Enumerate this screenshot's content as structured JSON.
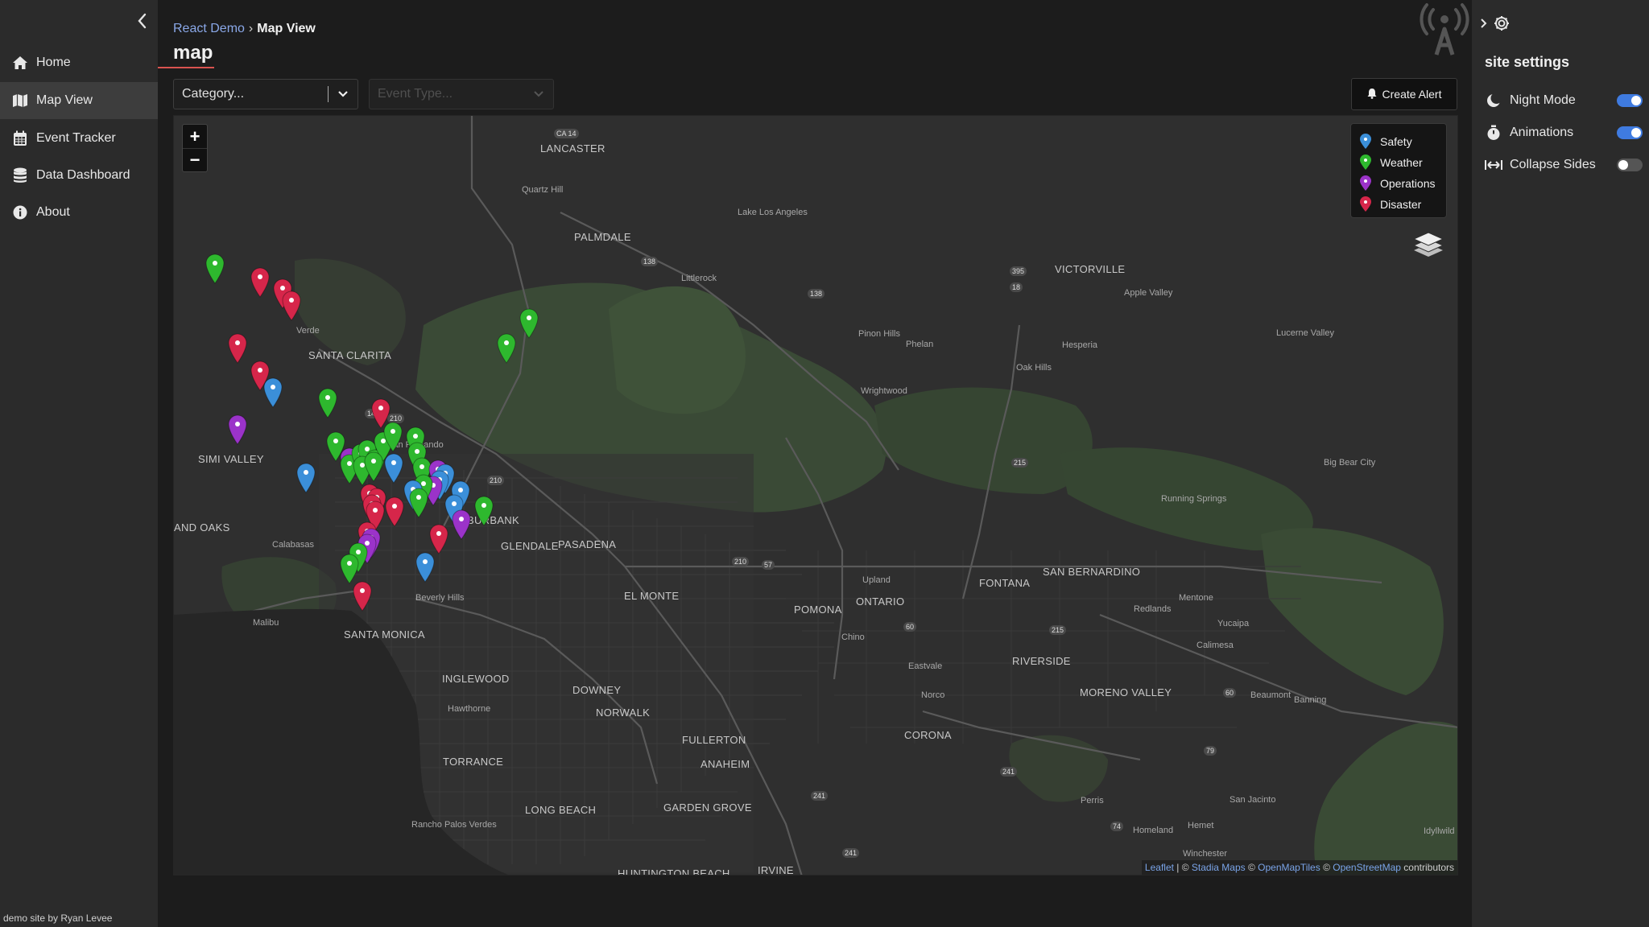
{
  "sidebar": {
    "items": [
      {
        "label": "Home",
        "icon": "home-icon"
      },
      {
        "label": "Map View",
        "icon": "map-icon"
      },
      {
        "label": "Event Tracker",
        "icon": "calendar-icon"
      },
      {
        "label": "Data Dashboard",
        "icon": "database-icon"
      },
      {
        "label": "About",
        "icon": "info-icon"
      }
    ],
    "active_item": "Map View",
    "footer": "demo site by Ryan Levee"
  },
  "header": {
    "breadcrumb": {
      "root": "React Demo",
      "separator": "›",
      "current": "Map View"
    },
    "title": "map"
  },
  "filters": {
    "category_placeholder": "Category...",
    "event_type_placeholder": "Event Type...",
    "create_alert_label": "Create Alert"
  },
  "map": {
    "zoom_in": "+",
    "zoom_out": "−",
    "legend": [
      {
        "label": "Safety",
        "color": "#3b8fd9"
      },
      {
        "label": "Weather",
        "color": "#2eb82e"
      },
      {
        "label": "Operations",
        "color": "#9b33c9"
      },
      {
        "label": "Disaster",
        "color": "#d6264a"
      }
    ],
    "places": [
      "LANCASTER",
      "Quartz Hill",
      "PALMDALE",
      "Lake Los Angeles",
      "Littlerock",
      "VICTORVILLE",
      "Apple Valley",
      "Pinon Hills",
      "Phelan",
      "Hesperia",
      "Oak Hills",
      "Lucerne Valley",
      "Wrightwood",
      "Verde",
      "SANTA CLARITA",
      "SIMI VALLEY",
      "San Fernando",
      "AND OAKS",
      "Calabasas",
      "BURBANK",
      "GLENDALE",
      "PASADENA",
      "Big Bear City",
      "Running Springs",
      "FONTANA",
      "SAN BERNARDINO",
      "Mentone",
      "Redlands",
      "Yucaipa",
      "Calimesa",
      "EL MONTE",
      "POMONA",
      "ONTARIO",
      "Upland",
      "Chino",
      "Eastvale",
      "RIVERSIDE",
      "MORENO VALLEY",
      "Beaumont",
      "Banning",
      "Norco",
      "CORONA",
      "Malibu",
      "SANTA MONICA",
      "Beverly Hills",
      "INGLEWOOD",
      "Hawthorne",
      "DOWNEY",
      "NORWALK",
      "FULLERTON",
      "ANAHEIM",
      "TORRANCE",
      "LONG BEACH",
      "GARDEN GROVE",
      "Rancho Palos Verdes",
      "HUNTINGTON BEACH",
      "IRVINE",
      "Perris",
      "San Jacinto",
      "Hemet",
      "Homeland",
      "Winchester",
      "Idyllwild"
    ],
    "attribution": {
      "leaflet": "Leaflet",
      "sep1": " | © ",
      "stadia": "Stadia Maps",
      "sep2": " © ",
      "omt": "OpenMapTiles",
      "sep3": " © ",
      "osm": "OpenStreetMap",
      "tail": " contributors"
    }
  },
  "settings": {
    "title": "site settings",
    "items": [
      {
        "label": "Night Mode",
        "icon": "moon-icon",
        "on": true
      },
      {
        "label": "Animations",
        "icon": "stopwatch-icon",
        "on": true
      },
      {
        "label": "Collapse Sides",
        "icon": "arrows-horizontal-icon",
        "on": false
      }
    ]
  }
}
